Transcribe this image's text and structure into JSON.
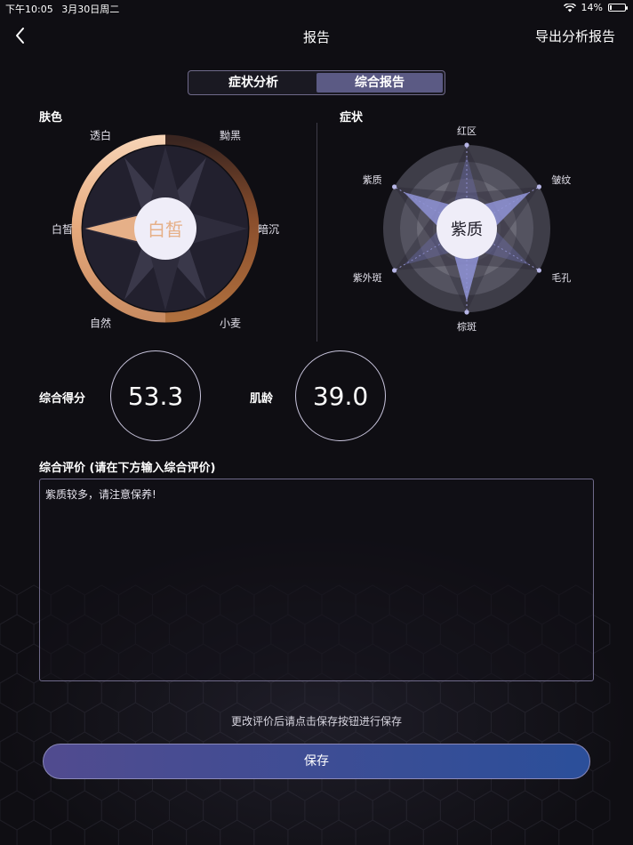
{
  "status": {
    "time": "下午10:05",
    "date": "3月30日周二",
    "battery": "14%",
    "battery_level": 0.14
  },
  "nav": {
    "title": "报告",
    "export_label": "导出分析报告"
  },
  "tabs": [
    {
      "label": "症状分析",
      "active": false
    },
    {
      "label": "综合报告",
      "active": true
    }
  ],
  "skin_color": {
    "section_label": "肤色",
    "center_text": "白皙",
    "labels": [
      "透白",
      "黝黑",
      "暗沉",
      "小麦",
      "自然",
      "白皙"
    ],
    "selected": "白皙"
  },
  "symptoms": {
    "section_label": "症状",
    "center_text": "紫质",
    "labels": [
      "红区",
      "皱纹",
      "毛孔",
      "棕斑",
      "紫外斑",
      "紫质"
    ]
  },
  "scores": {
    "overall_label": "综合得分",
    "overall_value": "53.3",
    "skin_age_label": "肌龄",
    "skin_age_value": "39.0"
  },
  "evaluation": {
    "title": "综合评价 (请在下方输入综合评价)",
    "text": "紫质较多，请注意保养!"
  },
  "hint": "更改评价后请点击保存按钮进行保存",
  "save_label": "保存",
  "colors": {
    "accent": "#5b5a84",
    "skin_highlight": "#e6b088",
    "radar_fill": "#8f93d6",
    "button_start": "#514b8f",
    "button_end": "#2b4f9a"
  }
}
